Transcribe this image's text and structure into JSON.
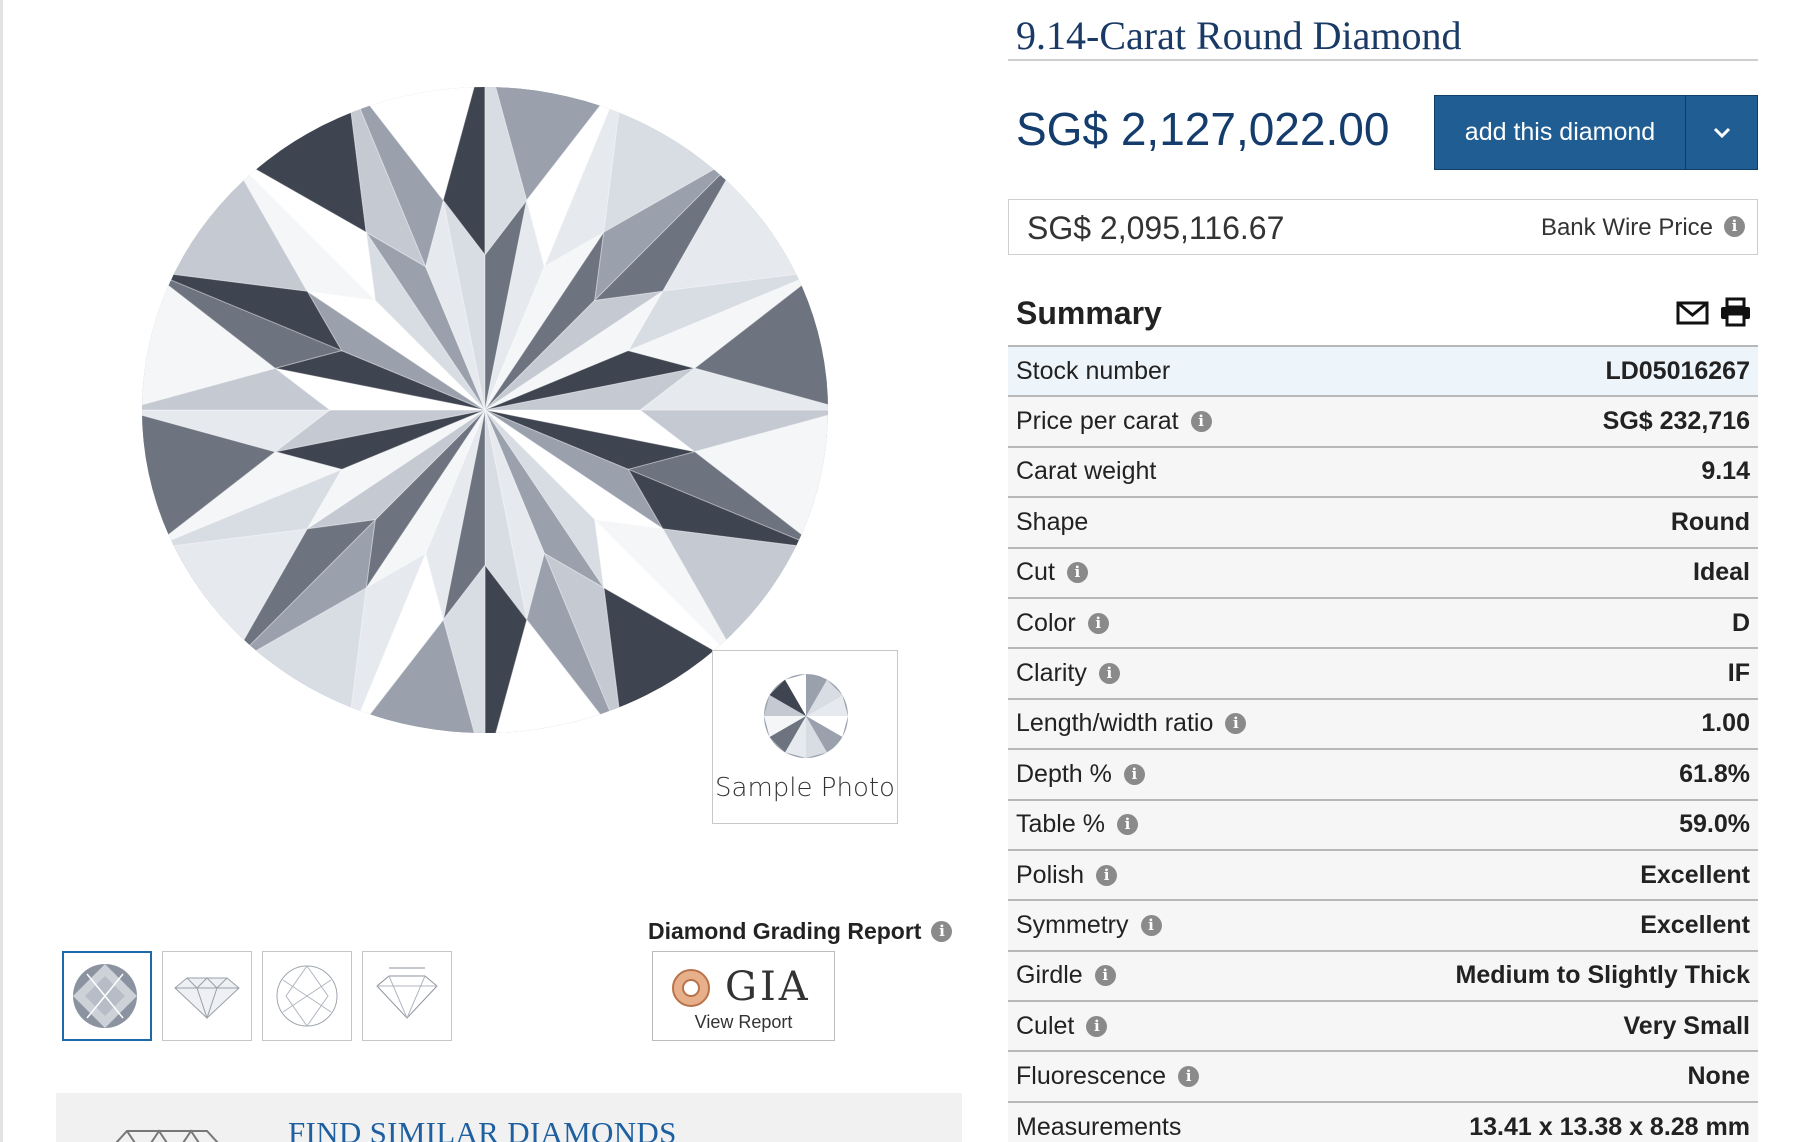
{
  "product": {
    "title": "9.14-Carat Round Diamond",
    "price": "SG$ 2,127,022.00",
    "add_button_label": "add this diamond",
    "bank_wire_price": "SG$ 2,095,116.67",
    "bank_wire_label": "Bank Wire Price"
  },
  "media": {
    "sample_caption": "Sample Photo",
    "thumbnails": [
      "diamond-photo",
      "side-profile-diagram",
      "top-facet-diagram",
      "proportions-diagram"
    ],
    "grading_title": "Diamond Grading Report",
    "gia_logo": "GIA",
    "gia_link": "View Report"
  },
  "similar": {
    "label": "FIND SIMILAR DIAMONDS"
  },
  "summary": {
    "heading": "Summary",
    "rows": [
      {
        "key": "Stock number",
        "value": "LD05016267",
        "info": false
      },
      {
        "key": "Price per carat",
        "value": "SG$ 232,716",
        "info": true
      },
      {
        "key": "Carat weight",
        "value": "9.14",
        "info": false
      },
      {
        "key": "Shape",
        "value": "Round",
        "info": false
      },
      {
        "key": "Cut",
        "value": "Ideal",
        "info": true
      },
      {
        "key": "Color",
        "value": "D",
        "info": true
      },
      {
        "key": "Clarity",
        "value": "IF",
        "info": true
      },
      {
        "key": "Length/width ratio",
        "value": "1.00",
        "info": true
      },
      {
        "key": "Depth %",
        "value": "61.8%",
        "info": true
      },
      {
        "key": "Table %",
        "value": "59.0%",
        "info": true
      },
      {
        "key": "Polish",
        "value": "Excellent",
        "info": true
      },
      {
        "key": "Symmetry",
        "value": "Excellent",
        "info": true
      },
      {
        "key": "Girdle",
        "value": "Medium to Slightly Thick",
        "info": true
      },
      {
        "key": "Culet",
        "value": "Very Small",
        "info": true
      },
      {
        "key": "Fluorescence",
        "value": "None",
        "info": true
      },
      {
        "key": "Measurements",
        "value": "13.41 x 13.38 x 8.28 mm",
        "info": false
      }
    ]
  },
  "colors": {
    "accent": "#1f5d92",
    "title": "#1a3a66",
    "link": "#1e5fa0"
  }
}
